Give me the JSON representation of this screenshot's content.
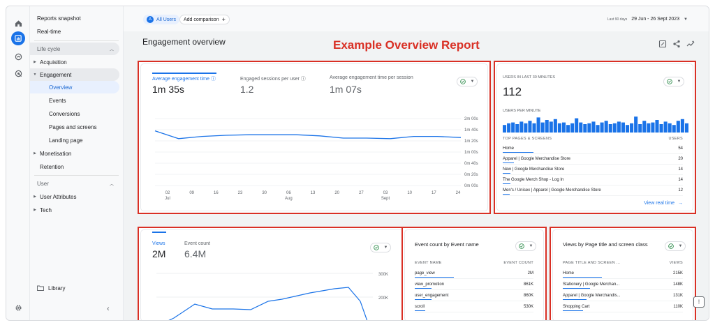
{
  "nav": {
    "reports_snapshot": "Reports snapshot",
    "realtime": "Real-time",
    "lifecycle": "Life cycle",
    "acquisition": "Acquisition",
    "engagement": "Engagement",
    "sub": [
      "Overview",
      "Events",
      "Conversions",
      "Pages and screens",
      "Landing page"
    ],
    "monetisation": "Monetisation",
    "retention": "Retention",
    "user": "User",
    "user_attributes": "User Attributes",
    "tech": "Tech",
    "library": "Library"
  },
  "topbar": {
    "all_users_letter": "A",
    "all_users": "All Users",
    "add_comparison": "Add comparison",
    "range_prefix": "Last 90 days",
    "range": "29 Jun - 26 Sept 2023"
  },
  "page": {
    "title": "Engagement overview",
    "overlay_label": "Example Overview Report"
  },
  "engagement_card": {
    "metrics": [
      {
        "label": "Average engagement time",
        "value": "1m 35s"
      },
      {
        "label": "Engaged sessions per user",
        "value": "1.2"
      },
      {
        "label": "Average engagement time per session",
        "value": "1m 07s"
      }
    ]
  },
  "realtime_card": {
    "users_label": "USERS IN LAST 30 MINUTES",
    "users_value": "112",
    "per_minute_label": "USERS PER MINUTE",
    "table_header_left": "TOP PAGES & SCREENS",
    "table_header_right": "USERS",
    "rows": [
      {
        "name": "Home",
        "value": "54",
        "share": 1.0
      },
      {
        "name": "Apparel | Google Merchandise Store",
        "value": "20",
        "share": 0.37
      },
      {
        "name": "New | Google Merchandise Store",
        "value": "14",
        "share": 0.26
      },
      {
        "name": "The Google Merch Shop - Log In",
        "value": "14",
        "share": 0.26
      },
      {
        "name": "Men's / Unisex | Apparel | Google Merchandise Store",
        "value": "12",
        "share": 0.22
      }
    ],
    "view_link": "View real time",
    "bars": [
      0.45,
      0.55,
      0.6,
      0.5,
      0.65,
      0.55,
      0.7,
      0.55,
      0.9,
      0.6,
      0.75,
      0.65,
      0.8,
      0.55,
      0.6,
      0.45,
      0.55,
      0.85,
      0.6,
      0.5,
      0.55,
      0.65,
      0.45,
      0.6,
      0.7,
      0.5,
      0.55,
      0.65,
      0.6,
      0.45,
      0.55,
      0.95,
      0.5,
      0.7,
      0.55,
      0.6,
      0.75,
      0.5,
      0.65,
      0.55,
      0.45,
      0.7,
      0.8,
      0.55
    ]
  },
  "views_card": {
    "metrics": [
      {
        "label": "Views",
        "value": "2M"
      },
      {
        "label": "Event count",
        "value": "6.4M"
      }
    ],
    "y_ticks": [
      "300K",
      "200K"
    ]
  },
  "events_card": {
    "title": "Event count by Event name",
    "header_left": "EVENT NAME",
    "header_right": "EVENT COUNT",
    "rows": [
      {
        "name": "page_view",
        "value": "2M",
        "share": 1.0
      },
      {
        "name": "view_promotion",
        "value": "861K",
        "share": 0.43
      },
      {
        "name": "user_engagement",
        "value": "860K",
        "share": 0.43
      },
      {
        "name": "scroll",
        "value": "530K",
        "share": 0.27
      }
    ]
  },
  "pages_card": {
    "title": "Views by Page title and screen class",
    "header_left": "PAGE TITLE AND SCREEN ...",
    "header_right": "VIEWS",
    "rows": [
      {
        "name": "Home",
        "value": "215K",
        "share": 1.0
      },
      {
        "name": "Stationery | Google Merchan...",
        "value": "148K",
        "share": 0.69
      },
      {
        "name": "Apparel | Google Merchandis...",
        "value": "131K",
        "share": 0.61
      },
      {
        "name": "Shopping Cart",
        "value": "110K",
        "share": 0.51
      }
    ]
  },
  "chart_data": {
    "type": "line",
    "x": [
      "02 Jul",
      "09",
      "16",
      "23",
      "30",
      "06 Aug",
      "13",
      "20",
      "27",
      "03 Sept",
      "10",
      "17",
      "24"
    ],
    "x_tick_labels": [
      "02",
      "09",
      "16",
      "23",
      "30",
      "06",
      "13",
      "20",
      "27",
      "03",
      "10",
      "17",
      "24"
    ],
    "x_month_labels": [
      {
        "at": 0,
        "label": "Jul"
      },
      {
        "at": 5,
        "label": "Aug"
      },
      {
        "at": 9,
        "label": "Sept"
      }
    ],
    "y_ticks": [
      "0m 00s",
      "0m 20s",
      "0m 40s",
      "1m 00s",
      "1m 20s",
      "1m 40s",
      "2m 00s"
    ],
    "ylim": [
      0,
      120
    ],
    "series": [
      {
        "name": "Average engagement time",
        "values": [
          98,
          84,
          88,
          90,
          91,
          91,
          91,
          89,
          85,
          85,
          84,
          88,
          88,
          86
        ]
      }
    ],
    "color": "#1a73e8"
  }
}
